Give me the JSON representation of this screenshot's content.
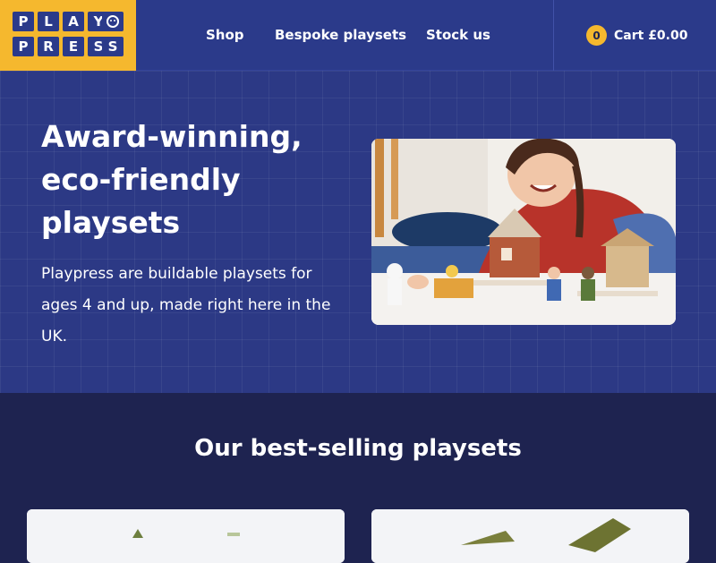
{
  "header": {
    "logo": {
      "letters_top": [
        "P",
        "L",
        "A",
        "Y"
      ],
      "letters_bottom": [
        "P",
        "R",
        "E",
        "S",
        "S"
      ],
      "brand": "PLAYPRESS"
    },
    "nav": [
      {
        "label": "Shop"
      },
      {
        "label": "Bespoke playsets"
      },
      {
        "label": "Stock us"
      }
    ],
    "cart": {
      "count": "0",
      "label": "Cart £0.00"
    }
  },
  "hero": {
    "title": "Award-winning, eco-friendly playsets",
    "description": "Playpress are buildable playsets for ages 4 and up, made right here in the UK.",
    "image_icon": "photo-child-playing-icon"
  },
  "bestsellers": {
    "title": "Our best-selling playsets"
  },
  "colors": {
    "brand_yellow": "#f5b82e",
    "header_blue": "#2b3a8a",
    "hero_blue": "#2c3985",
    "dark_navy": "#1e2350"
  }
}
